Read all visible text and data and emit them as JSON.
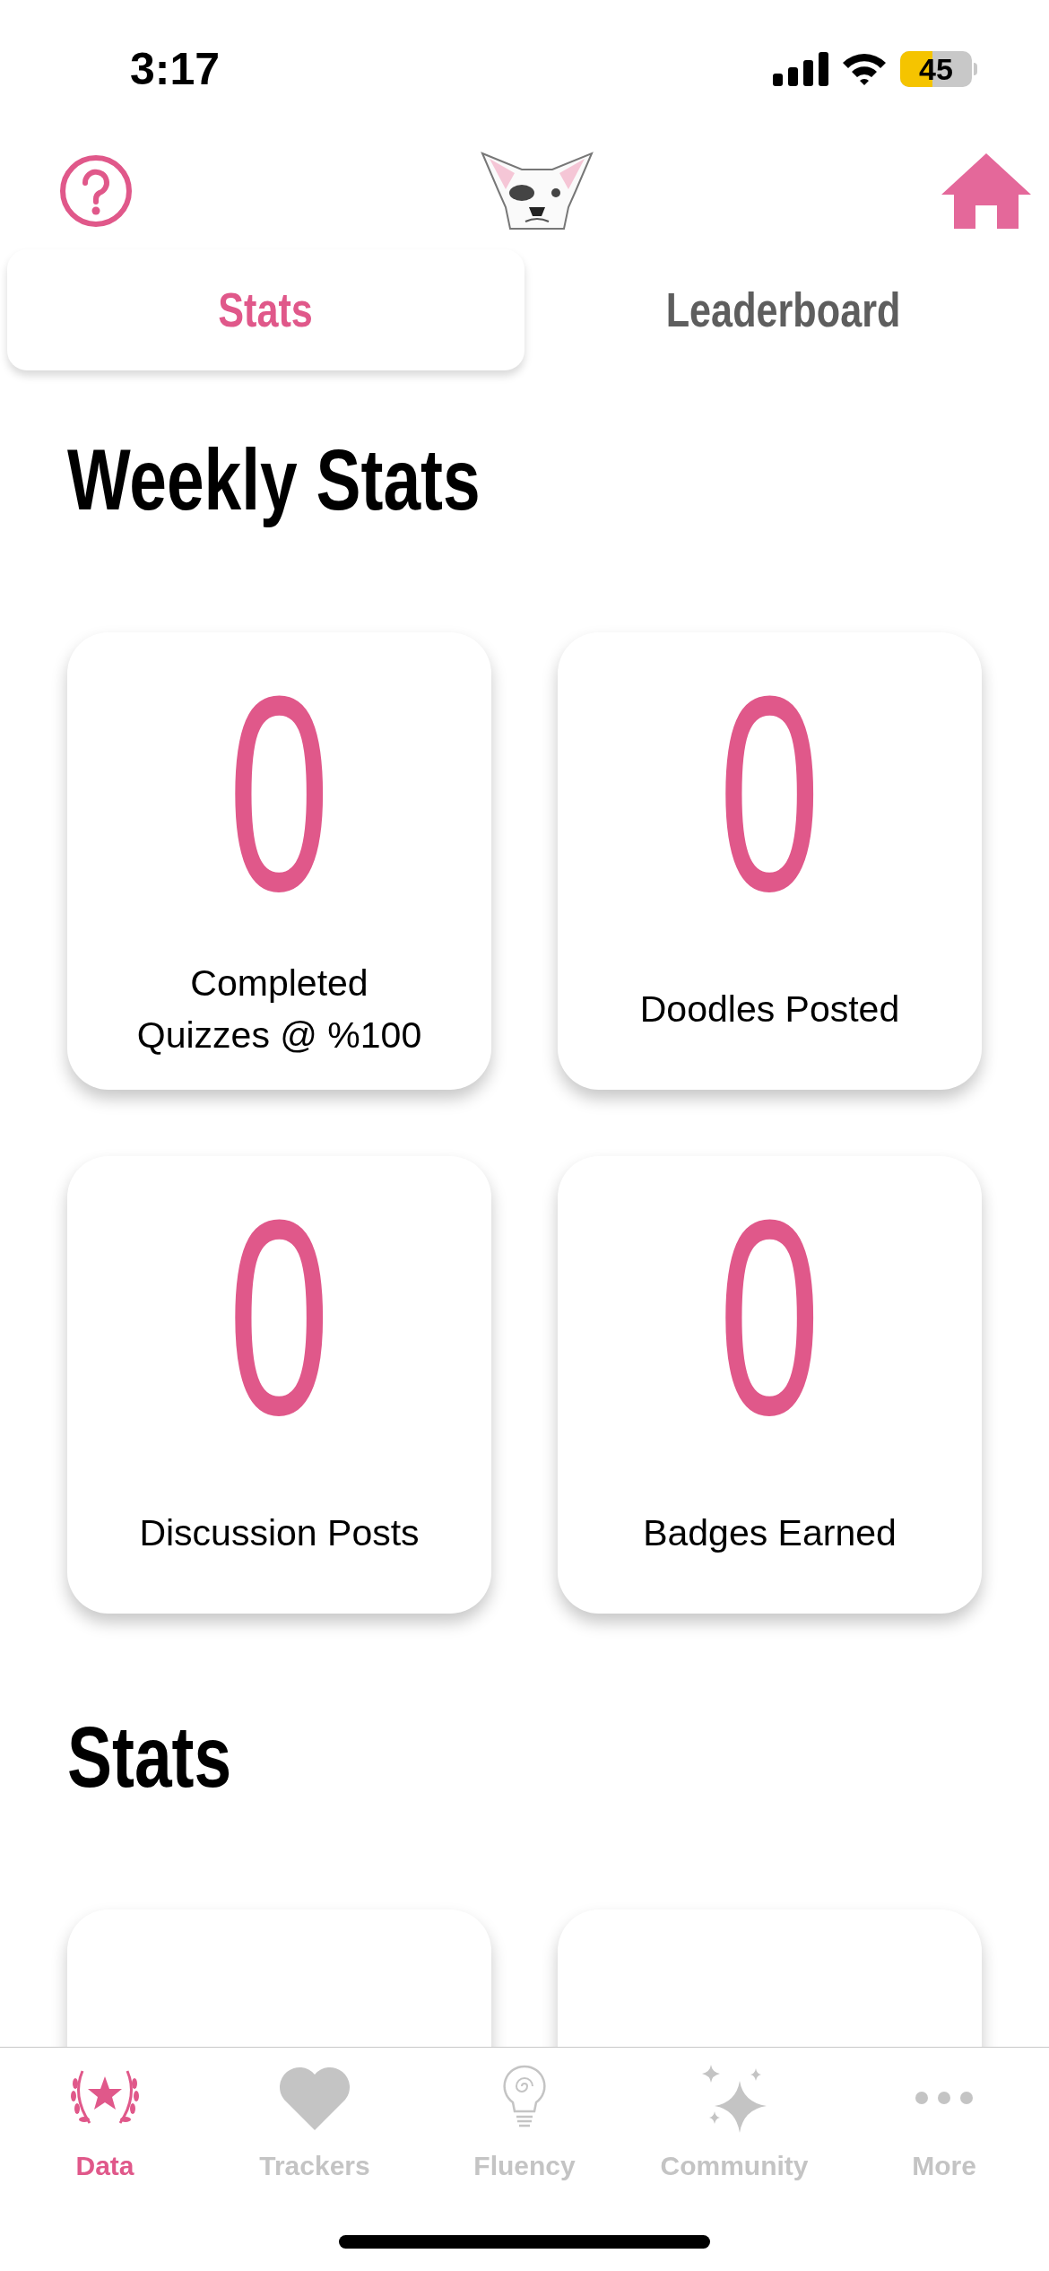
{
  "status_bar": {
    "time": "3:17",
    "battery": "45"
  },
  "tabs": [
    {
      "label": "Stats",
      "selected": true
    },
    {
      "label": "Leaderboard",
      "selected": false
    }
  ],
  "sections": [
    {
      "title": "Weekly Stats",
      "cards": [
        {
          "value": "0",
          "label": "Completed\nQuizzes @ %100"
        },
        {
          "value": "0",
          "label": "Doodles Posted"
        },
        {
          "value": "0",
          "label": "Discussion Posts"
        },
        {
          "value": "0",
          "label": "Badges Earned"
        }
      ]
    },
    {
      "title": "Stats",
      "cards_cut_off": true
    }
  ],
  "tab_bar": [
    {
      "label": "Data",
      "kind": "laurel",
      "selected": true
    },
    {
      "label": "Trackers",
      "kind": "heart",
      "selected": false
    },
    {
      "label": "Fluency",
      "kind": "bulb",
      "selected": false
    },
    {
      "label": "Community",
      "kind": "sparkles",
      "selected": false
    },
    {
      "label": "More",
      "kind": "dots",
      "selected": false
    }
  ]
}
